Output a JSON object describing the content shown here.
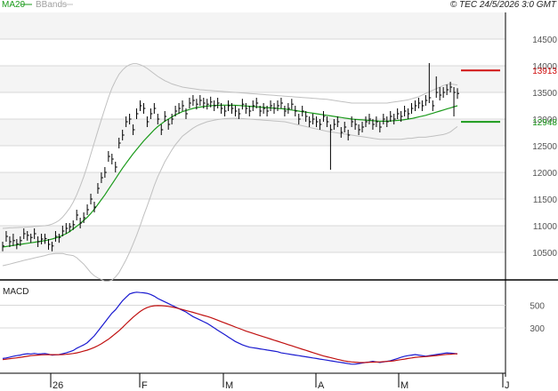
{
  "header": {
    "legend_ma": "MA20",
    "legend_bb": "BBands",
    "source_stamp": "© TEC 24/5/2026 3:0 GMT"
  },
  "colors": {
    "price_bars": "#000000",
    "ma20": "#1a9a1a",
    "bbands": "#c0c0c0",
    "resistance": "#d01010",
    "support": "#1a9a1a",
    "macd_line": "#1a1ad0",
    "signal_line": "#c01010",
    "grid": "#d8d8d8",
    "zebra": "#f4f4f4"
  },
  "chart_data": [
    {
      "type": "ohlc",
      "name": "price",
      "ylim": [
        10000,
        15000
      ],
      "yticks": [
        10500,
        11000,
        11500,
        12000,
        12500,
        13000,
        13500,
        14000,
        14500
      ],
      "ytick_labels": [
        "10500",
        "11000",
        "11500",
        "12000",
        "12500",
        "13000",
        "13500",
        "14000",
        "14500"
      ],
      "x_months": [
        {
          "label": "26",
          "day": 12
        },
        {
          "label": "F",
          "day": 44
        },
        {
          "label": "M",
          "day": 73
        },
        {
          "label": "A",
          "day": 104
        },
        {
          "label": "M",
          "day": 134
        },
        {
          "label": "J",
          "day": 165
        }
      ],
      "bars_close": [
        10620,
        10800,
        10700,
        10720,
        10660,
        10720,
        10850,
        10820,
        10780,
        10850,
        10700,
        10750,
        10760,
        10650,
        10620,
        10800,
        10780,
        10900,
        10950,
        10980,
        11020,
        11200,
        11050,
        11150,
        11300,
        11500,
        11350,
        11700,
        11900,
        12000,
        12300,
        12250,
        12100,
        12550,
        12700,
        12950,
        13000,
        12800,
        13100,
        13250,
        13200,
        12950,
        13100,
        13200,
        13000,
        12800,
        13050,
        12900,
        13000,
        13150,
        13200,
        13250,
        13100,
        13300,
        13350,
        13280,
        13350,
        13300,
        13280,
        13320,
        13250,
        13300,
        13200,
        13150,
        13250,
        13200,
        13150,
        13100,
        13280,
        13200,
        13150,
        13250,
        13300,
        13150,
        13200,
        13150,
        13250,
        13200,
        13250,
        13300,
        13150,
        13200,
        13280,
        13150,
        13000,
        13150,
        13050,
        12950,
        13000,
        12950,
        12900,
        13050,
        12950,
        12800,
        12900,
        12950,
        12750,
        12850,
        12700,
        12950,
        12900,
        12800,
        12850,
        12950,
        13000,
        12900,
        12950,
        12850,
        13000,
        12950,
        13050,
        13000,
        13100,
        13050,
        13150,
        13100,
        13200,
        13250,
        13300,
        13250,
        13350,
        13400,
        13250,
        13500,
        13450,
        13500,
        13550,
        13600,
        13500,
        13480
      ],
      "bars_high": [
        10700,
        10900,
        10800,
        10850,
        10750,
        10800,
        10950,
        10900,
        10850,
        10950,
        10800,
        10850,
        10850,
        10750,
        10700,
        10900,
        10850,
        11000,
        11050,
        11050,
        11100,
        11300,
        11150,
        11250,
        11400,
        11600,
        11450,
        11800,
        12000,
        12100,
        12400,
        12350,
        12200,
        12650,
        12800,
        13050,
        13100,
        12900,
        13200,
        13350,
        13300,
        13050,
        13200,
        13300,
        13100,
        12900,
        13150,
        13000,
        13100,
        13250,
        13300,
        13350,
        13200,
        13400,
        13450,
        13380,
        13450,
        13400,
        13380,
        13420,
        13350,
        13400,
        13300,
        13250,
        13350,
        13300,
        13250,
        13200,
        13380,
        13300,
        13250,
        13350,
        13400,
        13250,
        13300,
        13250,
        13350,
        13300,
        13350,
        13400,
        13250,
        13300,
        13380,
        13250,
        13100,
        13250,
        13150,
        13050,
        13100,
        13050,
        13000,
        13150,
        13050,
        12900,
        13000,
        13050,
        12850,
        12950,
        12800,
        13050,
        13000,
        12900,
        12950,
        13050,
        13100,
        13000,
        13050,
        12950,
        13100,
        13050,
        13150,
        13100,
        13200,
        13150,
        13250,
        13200,
        13300,
        13350,
        13400,
        13350,
        13450,
        14050,
        13350,
        13800,
        13600,
        13600,
        13650,
        13700,
        13600,
        13580
      ],
      "bars_low": [
        10520,
        10700,
        10600,
        10620,
        10560,
        10620,
        10750,
        10720,
        10680,
        10750,
        10600,
        10650,
        10660,
        10550,
        10520,
        10700,
        10680,
        10800,
        10850,
        10880,
        10920,
        11100,
        10950,
        11050,
        11200,
        11400,
        11250,
        11600,
        11800,
        11900,
        12200,
        12150,
        12000,
        12450,
        12600,
        12850,
        12900,
        12700,
        13000,
        13150,
        13100,
        12850,
        13000,
        13100,
        12900,
        12700,
        12950,
        12800,
        12900,
        13050,
        13100,
        13150,
        13000,
        13200,
        13250,
        13180,
        13250,
        13200,
        13180,
        13220,
        13150,
        13200,
        13100,
        13050,
        13150,
        13100,
        13050,
        13000,
        13180,
        13100,
        13050,
        13150,
        13200,
        13050,
        13100,
        13050,
        13150,
        13100,
        13150,
        13200,
        13050,
        13100,
        13180,
        13050,
        12900,
        13050,
        12950,
        12850,
        12900,
        12850,
        12800,
        12950,
        12850,
        12050,
        12800,
        12850,
        12650,
        12750,
        12600,
        12850,
        12800,
        12700,
        12750,
        12850,
        12900,
        12800,
        12850,
        12750,
        12900,
        12850,
        12950,
        12900,
        13000,
        12950,
        13050,
        13000,
        13100,
        13150,
        13200,
        13150,
        13250,
        13300,
        13150,
        13400,
        13350,
        13400,
        13450,
        13500,
        13050,
        13380
      ],
      "ma20": [
        10600,
        10610,
        10620,
        10630,
        10640,
        10650,
        10660,
        10670,
        10680,
        10690,
        10700,
        10710,
        10720,
        10735,
        10750,
        10770,
        10790,
        10820,
        10850,
        10890,
        10940,
        10990,
        11040,
        11100,
        11160,
        11230,
        11310,
        11400,
        11490,
        11580,
        11680,
        11780,
        11880,
        11980,
        12080,
        12170,
        12260,
        12350,
        12430,
        12510,
        12590,
        12660,
        12730,
        12800,
        12860,
        12910,
        12960,
        13000,
        13040,
        13080,
        13110,
        13140,
        13160,
        13180,
        13200,
        13215,
        13225,
        13235,
        13245,
        13250,
        13255,
        13258,
        13260,
        13262,
        13262,
        13260,
        13258,
        13255,
        13250,
        13245,
        13240,
        13235,
        13230,
        13225,
        13220,
        13215,
        13210,
        13205,
        13200,
        13195,
        13190,
        13180,
        13170,
        13160,
        13150,
        13140,
        13130,
        13120,
        13110,
        13100,
        13090,
        13080,
        13070,
        13060,
        13050,
        13040,
        13030,
        13020,
        13010,
        13000,
        12995,
        12990,
        12985,
        12980,
        12975,
        12970,
        12965,
        12960,
        12960,
        12960,
        12965,
        12970,
        12975,
        12980,
        12990,
        13000,
        13010,
        13025,
        13040,
        13055,
        13070,
        13090,
        13110,
        13130,
        13150,
        13170,
        13190,
        13210,
        13230,
        13250
      ],
      "bb_upper": [
        10950,
        10955,
        10960,
        10962,
        10965,
        10968,
        10970,
        10975,
        10980,
        10985,
        10990,
        10995,
        11000,
        11010,
        11030,
        11060,
        11100,
        11160,
        11240,
        11330,
        11440,
        11580,
        11740,
        11920,
        12120,
        12340,
        12560,
        12780,
        12990,
        13200,
        13400,
        13580,
        13720,
        13840,
        13920,
        13980,
        14020,
        14040,
        14040,
        14020,
        13990,
        13950,
        13900,
        13850,
        13800,
        13760,
        13720,
        13690,
        13660,
        13640,
        13620,
        13600,
        13590,
        13580,
        13570,
        13560,
        13550,
        13545,
        13540,
        13535,
        13530,
        13525,
        13520,
        13515,
        13510,
        13505,
        13500,
        13495,
        13490,
        13485,
        13480,
        13475,
        13470,
        13465,
        13460,
        13455,
        13450,
        13445,
        13440,
        13435,
        13430,
        13425,
        13420,
        13415,
        13410,
        13405,
        13400,
        13395,
        13390,
        13385,
        13380,
        13375,
        13370,
        13360,
        13350,
        13340,
        13330,
        13320,
        13310,
        13300,
        13300,
        13300,
        13300,
        13300,
        13300,
        13300,
        13300,
        13300,
        13300,
        13300,
        13310,
        13320,
        13330,
        13340,
        13350,
        13360,
        13380,
        13400,
        13420,
        13450,
        13480,
        13510,
        13540,
        13570,
        13600,
        13630,
        13650,
        13660,
        13650,
        13640
      ],
      "bb_lower": [
        10250,
        10265,
        10280,
        10298,
        10315,
        10332,
        10350,
        10365,
        10380,
        10395,
        10410,
        10425,
        10440,
        10460,
        10470,
        10480,
        10480,
        10480,
        10460,
        10450,
        10440,
        10400,
        10340,
        10280,
        10200,
        10120,
        10060,
        10020,
        9990,
        9960,
        9960,
        9980,
        10040,
        10120,
        10240,
        10360,
        10500,
        10660,
        10820,
        11000,
        11190,
        11370,
        11560,
        11750,
        11920,
        12060,
        12200,
        12310,
        12420,
        12520,
        12600,
        12680,
        12730,
        12780,
        12830,
        12870,
        12900,
        12925,
        12950,
        12965,
        12980,
        12991,
        13000,
        13009,
        13014,
        13015,
        13016,
        13015,
        13010,
        13005,
        13000,
        12995,
        12990,
        12985,
        12980,
        12975,
        12970,
        12965,
        12960,
        12955,
        12950,
        12935,
        12920,
        12905,
        12890,
        12875,
        12860,
        12845,
        12830,
        12815,
        12800,
        12785,
        12770,
        12760,
        12750,
        12740,
        12730,
        12720,
        12710,
        12700,
        12690,
        12680,
        12670,
        12660,
        12650,
        12640,
        12630,
        12620,
        12620,
        12620,
        12620,
        12620,
        12620,
        12620,
        12630,
        12640,
        12640,
        12650,
        12660,
        12660,
        12660,
        12670,
        12680,
        12690,
        12700,
        12710,
        12730,
        12760,
        12810,
        12860
      ],
      "levels": [
        {
          "name": "resistance",
          "value": 13913,
          "label": "13913"
        },
        {
          "name": "support",
          "value": 12948,
          "label": "12948"
        }
      ]
    },
    {
      "type": "line",
      "name": "MACD",
      "title": "MACD",
      "ylim": [
        -100,
        700
      ],
      "yticks": [
        300,
        500
      ],
      "ytick_labels": [
        "300",
        "500"
      ],
      "series": [
        {
          "name": "MACD",
          "values": [
            30,
            35,
            42,
            50,
            55,
            60,
            68,
            72,
            70,
            75,
            70,
            72,
            74,
            68,
            60,
            62,
            65,
            72,
            80,
            90,
            100,
            120,
            135,
            150,
            170,
            200,
            230,
            270,
            310,
            350,
            390,
            430,
            460,
            500,
            540,
            570,
            600,
            610,
            615,
            612,
            610,
            605,
            595,
            580,
            560,
            545,
            530,
            515,
            500,
            485,
            470,
            455,
            440,
            420,
            400,
            385,
            370,
            355,
            340,
            320,
            300,
            280,
            260,
            240,
            220,
            200,
            180,
            165,
            150,
            140,
            130,
            125,
            120,
            115,
            110,
            105,
            100,
            95,
            90,
            80,
            75,
            70,
            65,
            60,
            55,
            50,
            45,
            40,
            35,
            30,
            25,
            20,
            15,
            10,
            5,
            0,
            -5,
            -10,
            -15,
            -20,
            -20,
            -15,
            -10,
            -5,
            0,
            5,
            0,
            -5,
            0,
            5,
            10,
            20,
            30,
            40,
            50,
            55,
            60,
            65,
            60,
            55,
            50,
            55,
            60,
            65,
            70,
            75,
            80,
            78,
            75,
            72
          ]
        },
        {
          "name": "Signal",
          "values": [
            20,
            24,
            28,
            32,
            36,
            40,
            45,
            50,
            55,
            58,
            60,
            62,
            63,
            64,
            64,
            64,
            64,
            65,
            67,
            70,
            74,
            80,
            87,
            95,
            104,
            115,
            128,
            143,
            160,
            180,
            200,
            225,
            250,
            275,
            305,
            335,
            365,
            395,
            420,
            445,
            465,
            480,
            490,
            495,
            497,
            496,
            494,
            490,
            485,
            478,
            470,
            462,
            454,
            446,
            437,
            428,
            419,
            410,
            401,
            392,
            380,
            368,
            356,
            344,
            332,
            320,
            308,
            296,
            284,
            272,
            262,
            252,
            242,
            232,
            222,
            212,
            202,
            192,
            182,
            172,
            162,
            152,
            142,
            132,
            122,
            112,
            102,
            92,
            82,
            72,
            62,
            52,
            45,
            38,
            30,
            22,
            15,
            8,
            3,
            0,
            -3,
            -5,
            -6,
            -5,
            -3,
            -2,
            -1,
            0,
            2,
            4,
            6,
            10,
            15,
            20,
            25,
            30,
            35,
            40,
            43,
            45,
            47,
            50,
            53,
            56,
            60,
            63,
            66,
            68,
            70,
            72
          ]
        }
      ]
    }
  ]
}
